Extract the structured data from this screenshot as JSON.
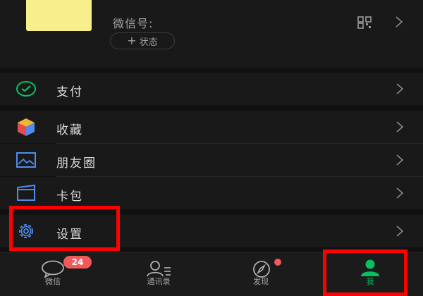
{
  "profile": {
    "wechat_id_label": "微信号:",
    "status_plus": "+",
    "status_label": "状态",
    "qr_icon": "qr-code-icon",
    "chevron": "chevron-right-icon"
  },
  "menu": {
    "pay": {
      "label": "支付",
      "icon": "wallet-check-icon",
      "color": "#07c160"
    },
    "favorites": {
      "label": "收藏",
      "icon": "cube-icon"
    },
    "moments": {
      "label": "朋友圈",
      "icon": "photo-frame-icon",
      "color": "#4e8cf0"
    },
    "cards": {
      "label": "卡包",
      "icon": "card-holder-icon",
      "color": "#4e8cf0"
    },
    "settings": {
      "label": "设置",
      "icon": "gear-icon",
      "color": "#4e8cf0"
    }
  },
  "tabbar": {
    "chats": {
      "label": "微信",
      "badge": "24",
      "icon": "chat-bubble-icon"
    },
    "contacts": {
      "label": "通讯录",
      "icon": "contacts-icon"
    },
    "discover": {
      "label": "发现",
      "icon": "compass-icon",
      "has_dot": true
    },
    "me": {
      "label": "我",
      "icon": "person-icon",
      "active_color": "#07c160"
    }
  },
  "colors": {
    "background": "#111111",
    "row": "#191919",
    "annotation": "#ff0000",
    "badge": "#f15a5a"
  }
}
